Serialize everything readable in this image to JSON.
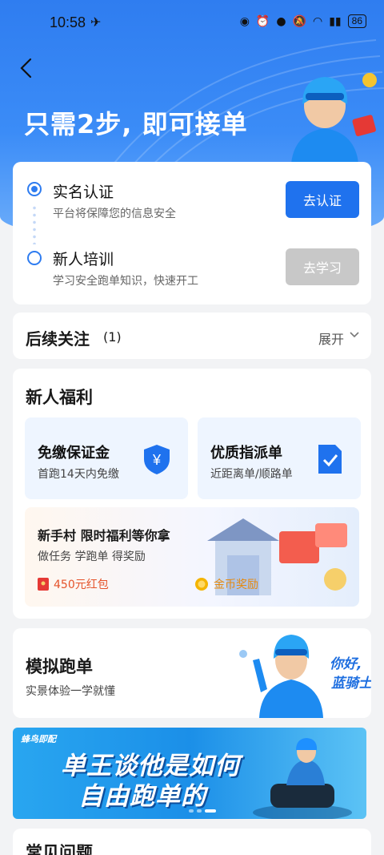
{
  "status_bar": {
    "time": "10:58",
    "battery": "86"
  },
  "header": {
    "title": "只需2步, 即可接单"
  },
  "steps": [
    {
      "title": "实名认证",
      "subtitle": "平台将保障您的信息安全",
      "button": "去认证"
    },
    {
      "title": "新人培训",
      "subtitle": "学习安全跑单知识，快速开工",
      "button": "去学习"
    }
  ],
  "followups": {
    "title": "后续关注",
    "count": "(1)",
    "expand_label": "展开"
  },
  "benefits": {
    "title": "新人福利",
    "tiles": [
      {
        "title": "免缴保证金",
        "subtitle": "首跑14天内免缴"
      },
      {
        "title": "优质指派单",
        "subtitle": "近距离单/顺路单"
      }
    ],
    "village": {
      "title": "新手村 限时福利等你拿",
      "subtitle": "做任务 学跑单 得奖励",
      "rewards": [
        "450元红包",
        "金币奖励"
      ]
    }
  },
  "simulate": {
    "title": "模拟跑单",
    "subtitle": "实景体验一学就懂",
    "art_text_1": "你好,",
    "art_text_2": "蓝骑士"
  },
  "banner": {
    "logo": "蜂鸟即配",
    "line1": "单王谈他是如何",
    "line2": "自由跑单的"
  },
  "faq": {
    "title": "常见问题"
  },
  "colors": {
    "primary": "#1f72ee",
    "hero": "#2f7df0",
    "disabled": "#c8c8c8"
  }
}
